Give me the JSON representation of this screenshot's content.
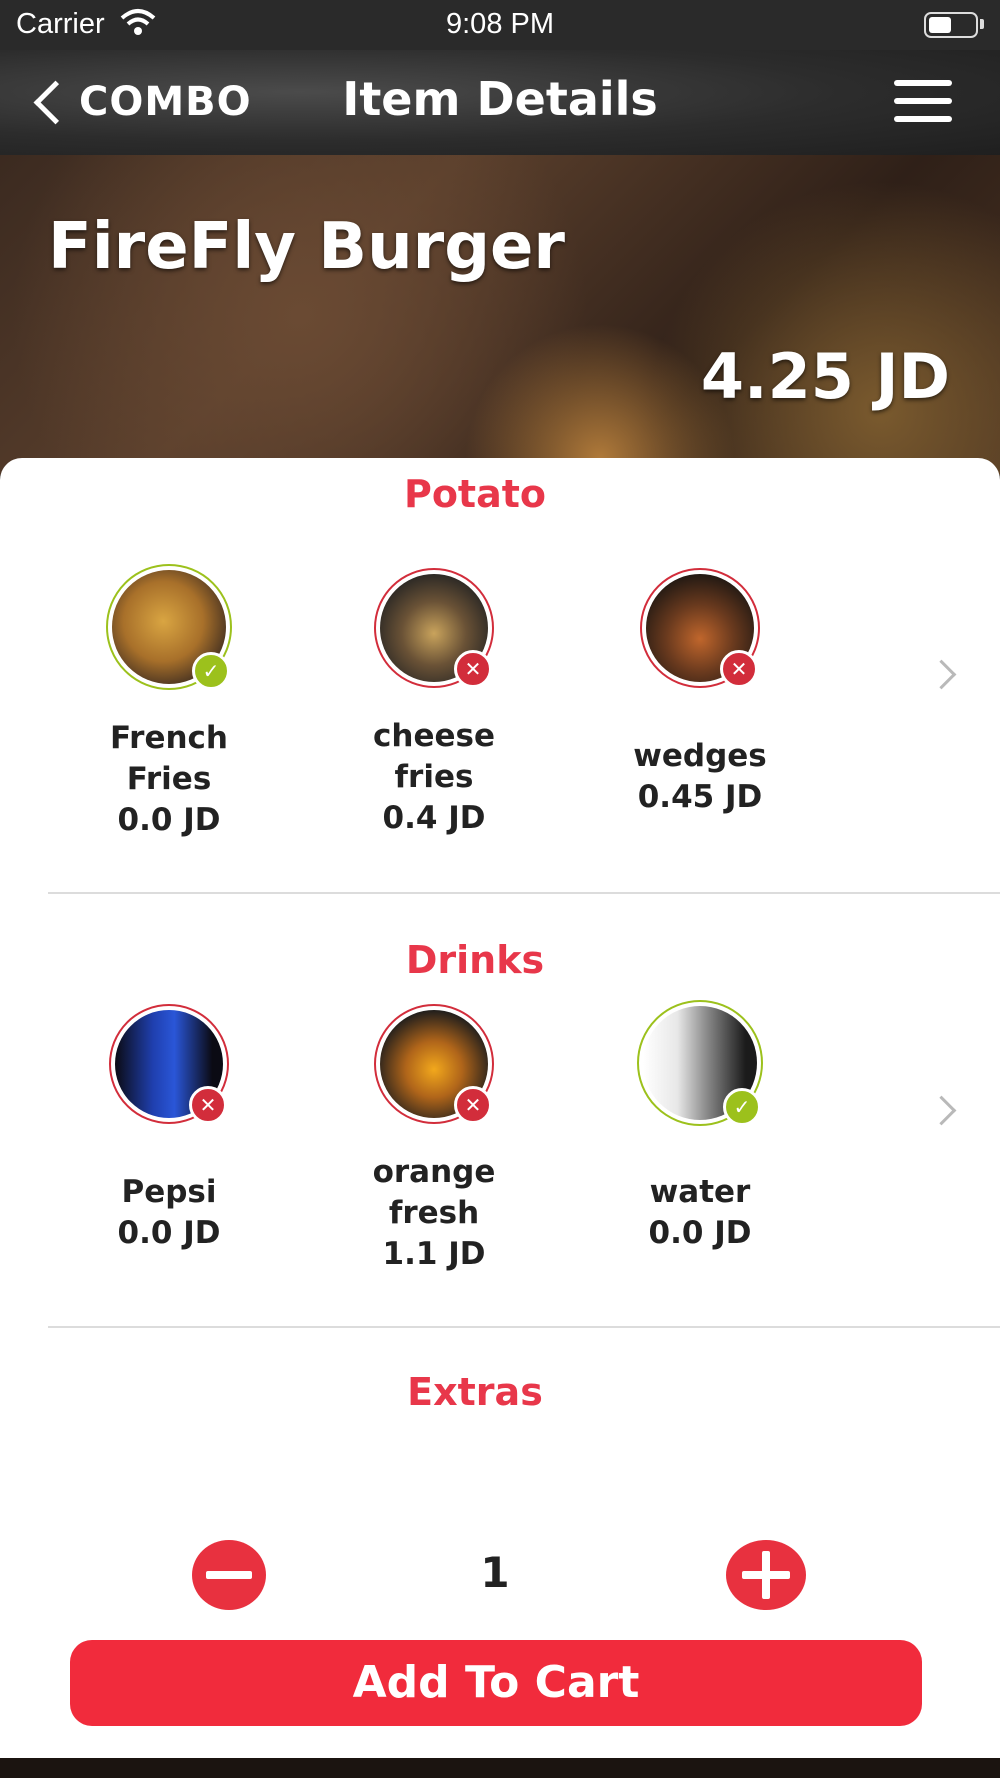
{
  "status_bar": {
    "carrier": "Carrier",
    "time": "9:08 PM"
  },
  "nav": {
    "back_label": "COMBO",
    "title": "Item Details"
  },
  "item": {
    "name": "FireFly Burger",
    "price": "4.25 JD"
  },
  "sections": [
    {
      "title": "Potato",
      "options": [
        {
          "name_lines": [
            "French",
            "Fries"
          ],
          "price": "0.0 JD",
          "selected": true
        },
        {
          "name_lines": [
            "cheese",
            "fries"
          ],
          "price": "0.4 JD",
          "selected": false
        },
        {
          "name_lines": [
            "wedges"
          ],
          "price": "0.45 JD",
          "selected": false
        }
      ]
    },
    {
      "title": "Drinks",
      "options": [
        {
          "name_lines": [
            "Pepsi"
          ],
          "price": "0.0 JD",
          "selected": false
        },
        {
          "name_lines": [
            "orange",
            "fresh"
          ],
          "price": "1.1 JD",
          "selected": false
        },
        {
          "name_lines": [
            "water"
          ],
          "price": "0.0 JD",
          "selected": true
        }
      ]
    },
    {
      "title": "Extras",
      "options": []
    }
  ],
  "quantity": "1",
  "add_to_cart_label": "Add To Cart",
  "colors": {
    "accent": "#f12b3c",
    "selected": "#9cc11c"
  }
}
